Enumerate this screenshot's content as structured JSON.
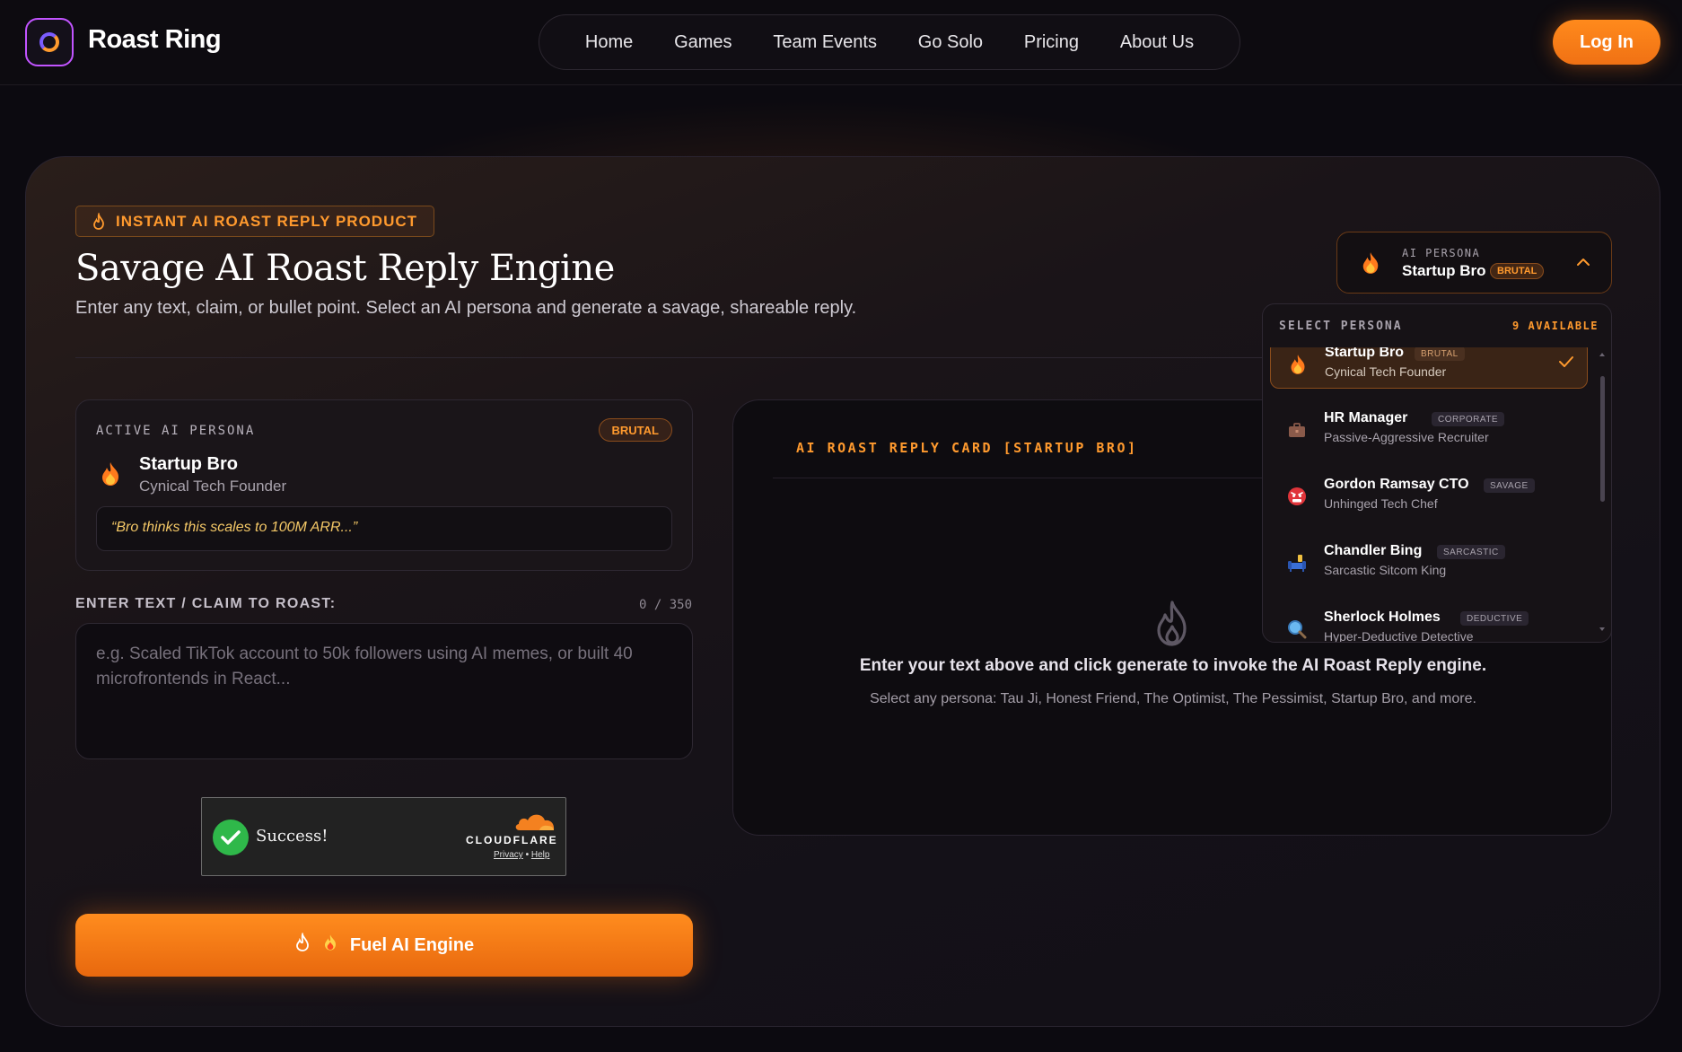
{
  "header": {
    "brand": "Roast Ring",
    "nav": [
      "Home",
      "Games",
      "Team Events",
      "Go Solo",
      "Pricing",
      "About Us"
    ],
    "login": "Log In"
  },
  "hero": {
    "tag": "INSTANT AI ROAST REPLY PRODUCT",
    "title": "Savage AI Roast Reply Engine",
    "subtitle": "Enter any text, claim, or bullet point. Select an AI persona and generate a savage, shareable reply."
  },
  "selector": {
    "label": "AI PERSONA",
    "name": "Startup Bro",
    "badge": "BRUTAL"
  },
  "dropdown": {
    "heading": "SELECT PERSONA",
    "count": "9 AVAILABLE",
    "items": [
      {
        "name": "Startup Bro",
        "tag": "BRUTAL",
        "sub": "Cynical Tech Founder",
        "icon": "fire-icon",
        "selected": true
      },
      {
        "name": "HR Manager",
        "tag": "CORPORATE",
        "sub": "Passive-Aggressive Recruiter",
        "icon": "briefcase-icon",
        "selected": false
      },
      {
        "name": "Gordon Ramsay CTO",
        "tag": "SAVAGE",
        "sub": "Unhinged Tech Chef",
        "icon": "angry-face-icon",
        "selected": false
      },
      {
        "name": "Chandler Bing",
        "tag": "SARCASTIC",
        "sub": "Sarcastic Sitcom King",
        "icon": "couch-icon",
        "selected": false
      },
      {
        "name": "Sherlock Holmes",
        "tag": "DEDUCTIVE",
        "sub": "Hyper-Deductive Detective",
        "icon": "magnifier-icon",
        "selected": false
      }
    ]
  },
  "active_persona": {
    "label": "ACTIVE AI PERSONA",
    "badge": "BRUTAL",
    "name": "Startup Bro",
    "role": "Cynical Tech Founder",
    "quote": "“Bro thinks this scales to 100M ARR...”"
  },
  "input": {
    "label": "ENTER TEXT / CLAIM TO ROAST:",
    "count": "0 / 350",
    "placeholder": "e.g. Scaled TikTok account to 50k followers using AI memes, or built 40 microfrontends in React..."
  },
  "captcha": {
    "status": "Success!",
    "brand": "CLOUDFLARE",
    "privacy": "Privacy",
    "sep": "•",
    "help": "Help"
  },
  "fuel_button": "Fuel AI Engine",
  "reply": {
    "heading": "AI ROAST REPLY CARD [STARTUP BRO]",
    "message": "Enter your text above and click generate to invoke the AI Roast Reply engine.",
    "hint": "Select any persona: Tau Ji, Honest Friend, The Optimist, The Pessimist, Startup Bro, and more."
  },
  "colors": {
    "accent": "#ff8a1c",
    "brutal": "#ff9a2e",
    "quote": "#f4c867",
    "success": "#2fb84a"
  }
}
